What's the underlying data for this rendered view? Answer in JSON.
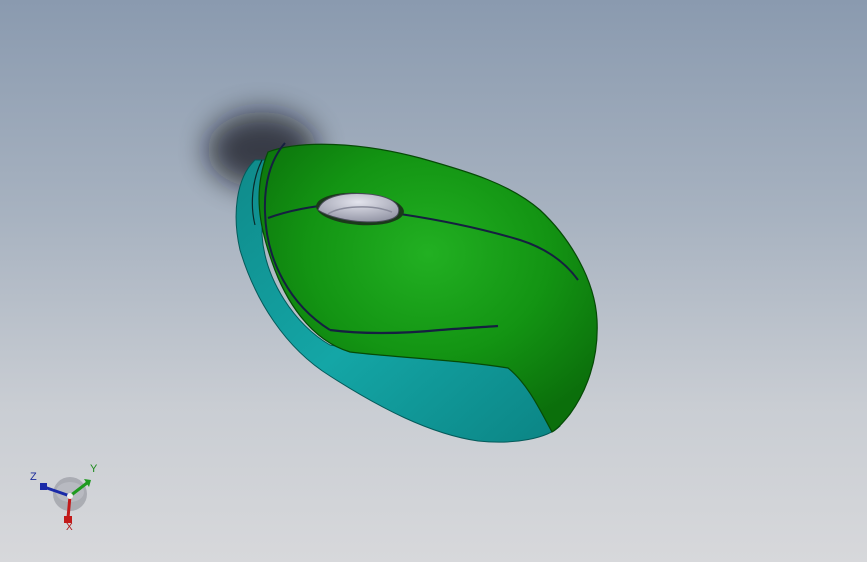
{
  "viewport": {
    "background_top": "#8a9aaf",
    "background_bottom": "#d7d8db"
  },
  "model": {
    "name": "mouse",
    "top_shell_color": "#129a12",
    "bottom_shell_color": "#12a2a2",
    "wheel_color": "#b4b6c6"
  },
  "triad": {
    "x_label": "X",
    "y_label": "Y",
    "z_label": "Z",
    "x_color": "#c21a1a",
    "y_color": "#1f9a1f",
    "z_color": "#1a2aa8"
  }
}
